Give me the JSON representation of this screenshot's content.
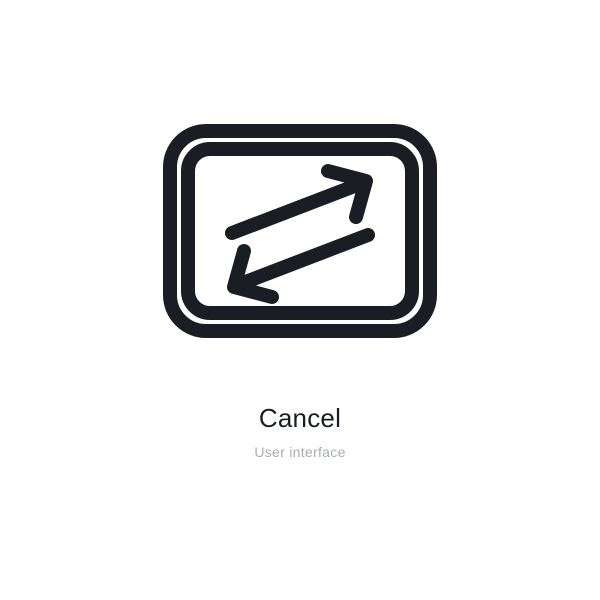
{
  "icon": {
    "name": "cancel-swap-icon",
    "stroke": "#1a1e24"
  },
  "labels": {
    "title": "Cancel",
    "subtitle": "User interface"
  }
}
